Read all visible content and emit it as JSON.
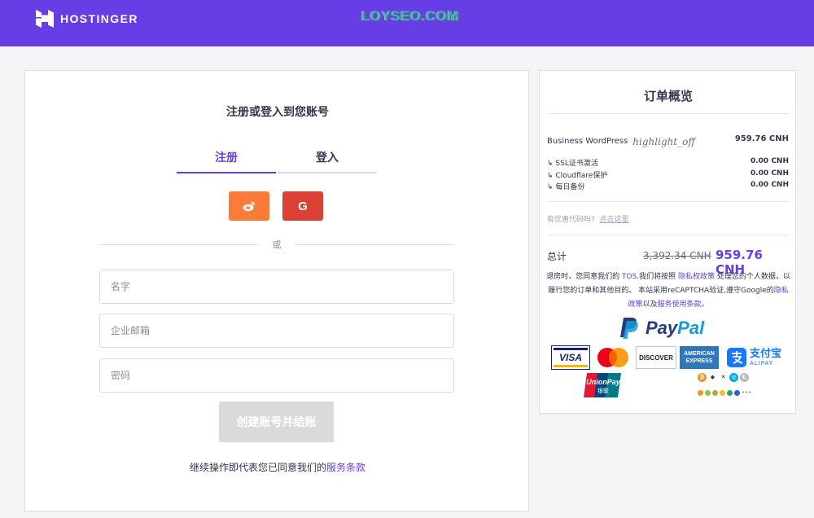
{
  "header": {
    "brand": "HOSTINGER",
    "watermark": "LOYSEO.COM",
    "accent": "#673de6"
  },
  "signup": {
    "title": "注册或登入到您账号",
    "tabs": [
      {
        "label": "注册",
        "active": true
      },
      {
        "label": "登入",
        "active": false
      }
    ],
    "social": [
      {
        "icon": "weibo-icon",
        "color": "#fb7c38"
      },
      {
        "icon": "google-icon",
        "letter": "G",
        "color": "#dc4135"
      }
    ],
    "or_label": "或",
    "fields": {
      "name_placeholder": "名字",
      "email_placeholder": "企业邮箱",
      "password_placeholder": "密码"
    },
    "submit_label": "创建账号并结账",
    "terms_prefix": "继续操作即代表您已同意我们的",
    "terms_link": "服务条款"
  },
  "summary": {
    "title": "订单概览",
    "product": "Business WordPress",
    "product_flag": "highlight_off",
    "product_price": "959.76 CNH",
    "addons": [
      {
        "label": "↳ SSL证书激活",
        "price": "0.00 CNH"
      },
      {
        "label": "↳ Cloudflare保护",
        "price": "0.00 CNH"
      },
      {
        "label": "↳ 每日备份",
        "price": "0.00 CNH"
      }
    ],
    "coupon_question": "有优惠代码吗?",
    "coupon_link": "点击这里",
    "total_label": "总计",
    "old_price": "3,392.34 CNH",
    "new_price": "959.76 CNH",
    "legal": {
      "t1": "退房时，您同意我们的 ",
      "tos": "TOS",
      "t2": ".我们将按照 ",
      "privacy": "隐私权政策",
      "t3": " 处理您的个人数据，以履行您的订单和其他目的。 本站采用reCAPTCHA验证,遵守Google的",
      "google_privacy": "隐私政策",
      "t4": "以及",
      "google_terms": "服务使用条款",
      "t5": "。"
    },
    "payment": {
      "paypal_pay": "Pay",
      "paypal_pal": "Pal",
      "visa": "VISA",
      "discover": "DISCOVER",
      "amex_line1": "AMERICAN",
      "amex_line2": "EXPRESS",
      "alipay_cn": "支付宝",
      "alipay_en": "ALIPAY",
      "unionpay": "UnionPay",
      "unionpay_cn": "银联"
    }
  }
}
